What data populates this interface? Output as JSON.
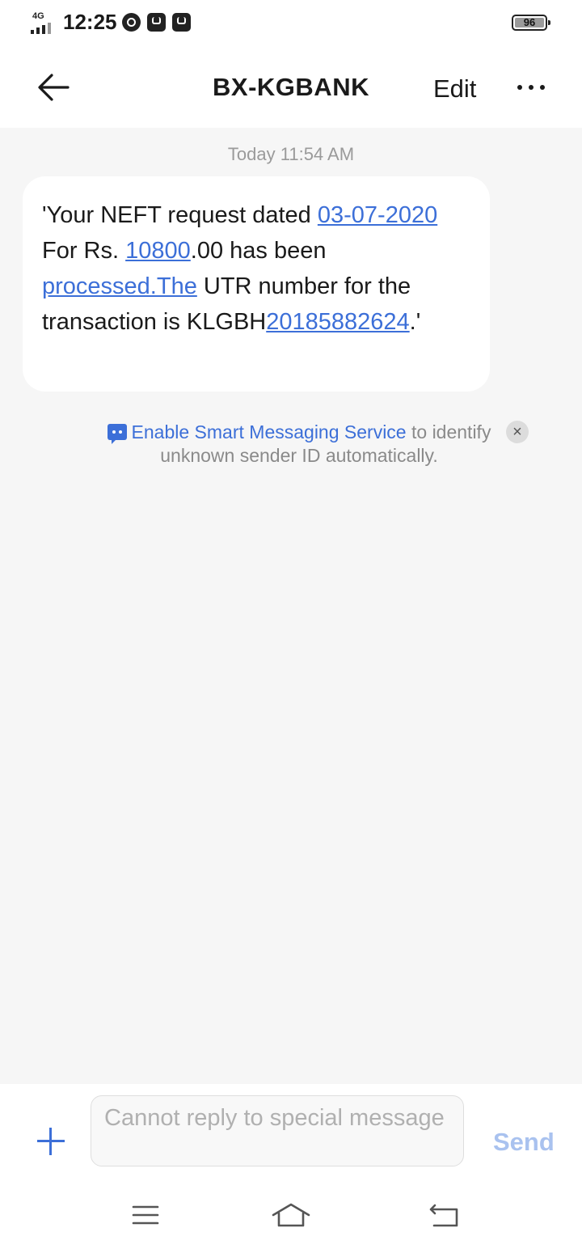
{
  "status_bar": {
    "network": "4G",
    "time": "12:25",
    "battery": "96"
  },
  "header": {
    "title": "BX-KGBANK",
    "edit_label": "Edit"
  },
  "conversation": {
    "timestamp": "Today 11:54 AM",
    "message": {
      "t1": "'Your NEFT request dated ",
      "link_date": "03-07-2020",
      "t2": " For Rs. ",
      "link_amount": "10800",
      "t3": ".00 has been ",
      "link_processed": "processed.The",
      "t4": " UTR number for the transaction is KLGBH",
      "link_utr": "20185882624",
      "t5": ".'"
    },
    "notice": {
      "link_text": "Enable Smart Messaging Service",
      "rest_text": " to identify unknown sender ID automatically."
    }
  },
  "composer": {
    "placeholder": "Cannot reply to special message",
    "send_label": "Send"
  },
  "colors": {
    "accent": "#3c6fd8",
    "background": "#f6f6f6",
    "bubble": "#ffffff",
    "send_disabled": "#a9c2ef"
  },
  "icons": {
    "back": "arrow-left-icon",
    "more": "more-horizontal-icon",
    "chat": "chat-bubble-icon",
    "close": "close-icon",
    "add": "plus-icon",
    "nav_menu": "menu-icon",
    "nav_home": "home-icon",
    "nav_back": "back-return-icon"
  }
}
